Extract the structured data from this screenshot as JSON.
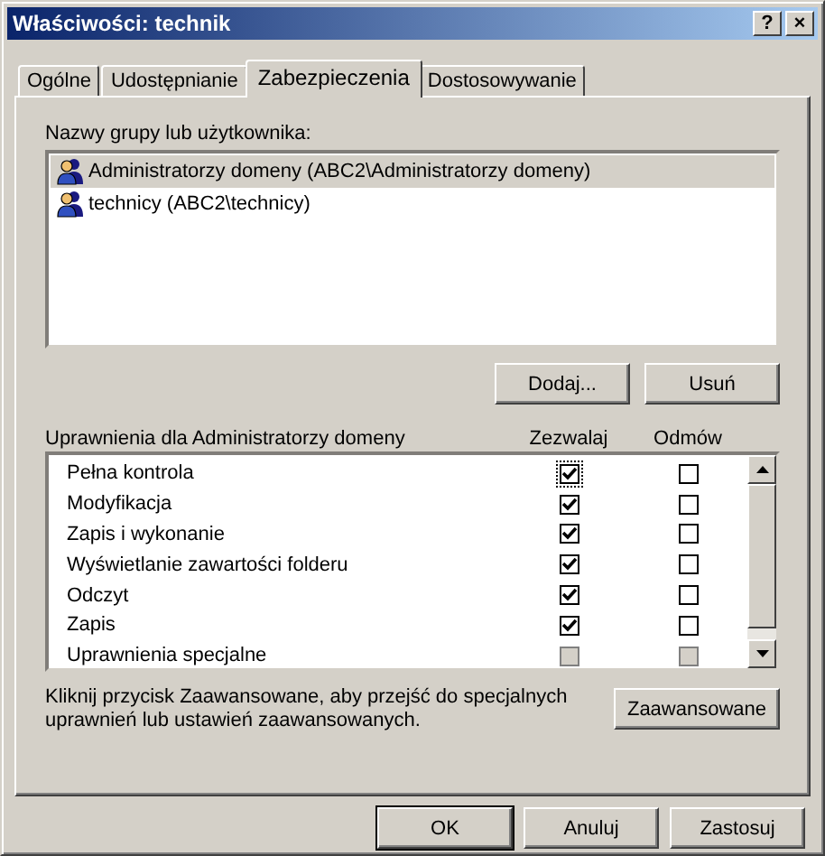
{
  "window": {
    "title": "Właściwości: technik",
    "buttons": [
      "?",
      "×"
    ]
  },
  "tabs": [
    {
      "label": "Ogólne",
      "selected": false
    },
    {
      "label": "Udostępnianie",
      "selected": false
    },
    {
      "label": "Zabezpieczenia",
      "selected": true
    },
    {
      "label": "Dostosowywanie",
      "selected": false
    }
  ],
  "users_label": "Nazwy grupy lub użytkownika:",
  "users": [
    {
      "name": "Administratorzy domeny (ABC2\\Administratorzy domeny)",
      "selected": true
    },
    {
      "name": "technicy (ABC2\\technicy)",
      "selected": false
    }
  ],
  "user_buttons": [
    "Dodaj...",
    "Usuń"
  ],
  "permissions": {
    "label": "Uprawnienia dla Administratorzy domeny",
    "columns": [
      "Zezwalaj",
      "Odmów"
    ],
    "rows": [
      {
        "name": "Pełna kontrola",
        "allow": true,
        "deny": false,
        "disabled": false
      },
      {
        "name": "Modyfikacja",
        "allow": true,
        "deny": false,
        "disabled": false
      },
      {
        "name": "Zapis i wykonanie",
        "allow": true,
        "deny": false,
        "disabled": false
      },
      {
        "name": "Wyświetlanie zawartości folderu",
        "allow": true,
        "deny": false,
        "disabled": false
      },
      {
        "name": "Odczyt",
        "allow": true,
        "deny": false,
        "disabled": false
      },
      {
        "name": "Zapis",
        "allow": true,
        "deny": false,
        "disabled": false
      },
      {
        "name": "Uprawnienia specjalne",
        "allow": false,
        "deny": false,
        "disabled": true
      }
    ]
  },
  "advanced": {
    "text": "Kliknij przycisk Zaawansowane, aby przejść do specjalnych uprawnień lub ustawień zaawansowanych.",
    "button": "Zaawansowane"
  },
  "footer_buttons": [
    {
      "label": "OK",
      "default": true
    },
    {
      "label": "Anuluj",
      "default": false
    },
    {
      "label": "Zastosuj",
      "default": false
    }
  ]
}
